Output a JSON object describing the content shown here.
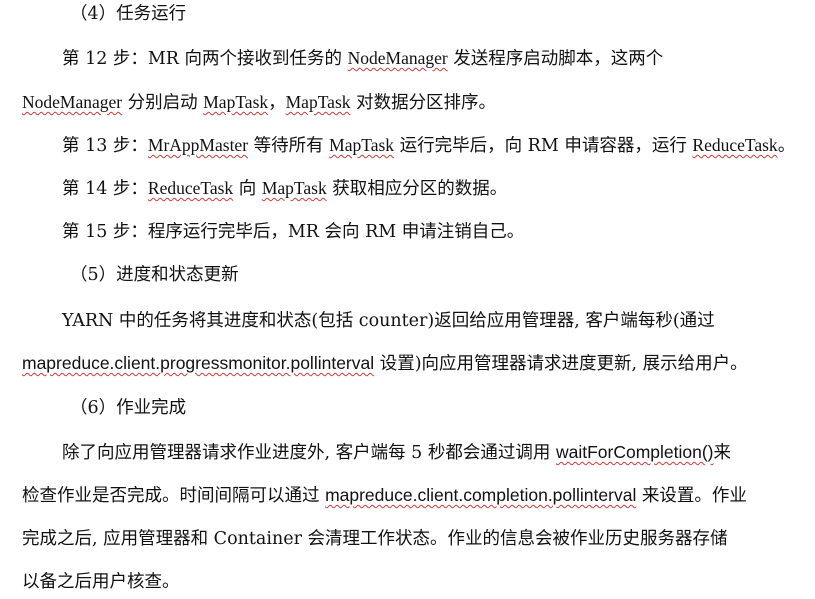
{
  "doc": {
    "h4": "（4）任务运行",
    "p1": {
      "a1": "第 12 步：MR 向两个接收到任务的 ",
      "nm1": "NodeManager",
      "a2": " 发送程序启动脚本，这两个",
      "nm2": "NodeManager",
      "b1": " 分别启动 ",
      "mt1": "MapTask",
      "b2": "，",
      "mt2": "MapTask",
      "b3": " 对数据分区排序。"
    },
    "p2": {
      "a1": "第 13 步：",
      "mr": "MrAppMaster",
      "a2": " 等待所有 ",
      "mt": "MapTask",
      "a3": " 运行完毕后，向 RM 申请容器，运行 ",
      "rt": "ReduceTask",
      "a4": "。"
    },
    "p3": {
      "a1": "第 14 步：",
      "rt": "ReduceTask",
      "a2": " 向 ",
      "mt": "MapTask",
      "a3": " 获取相应分区的数据。"
    },
    "p4": "第 15 步：程序运行完毕后，MR 会向 RM 申请注销自己。",
    "h5": "（5）进度和状态更新",
    "p5": {
      "a1": "YARN 中的任务将其进度和状态(包括 counter)返回给应用管理器, 客户端每秒(通过",
      "prop": "mapreduce.client.progressmonitor.pollinterval",
      "b1": " 设置)向应用管理器请求进度更新, 展示给用户。"
    },
    "h6": "（6）作业完成",
    "p6": {
      "a1": "除了向应用管理器请求作业进度外, 客户端每 5 秒都会通过调用 ",
      "wfc": "waitForCompletion()",
      "a2": "来",
      "b1": "检查作业是否完成。时间间隔可以通过 ",
      "prop": "mapreduce.client.completion.pollinterval",
      "b2": " 来设置。作业",
      "c1": "完成之后, 应用管理器和 Container 会清理工作状态。作业的信息会被作业历史服务器存储",
      "d1": "以备之后用户核查。"
    }
  }
}
